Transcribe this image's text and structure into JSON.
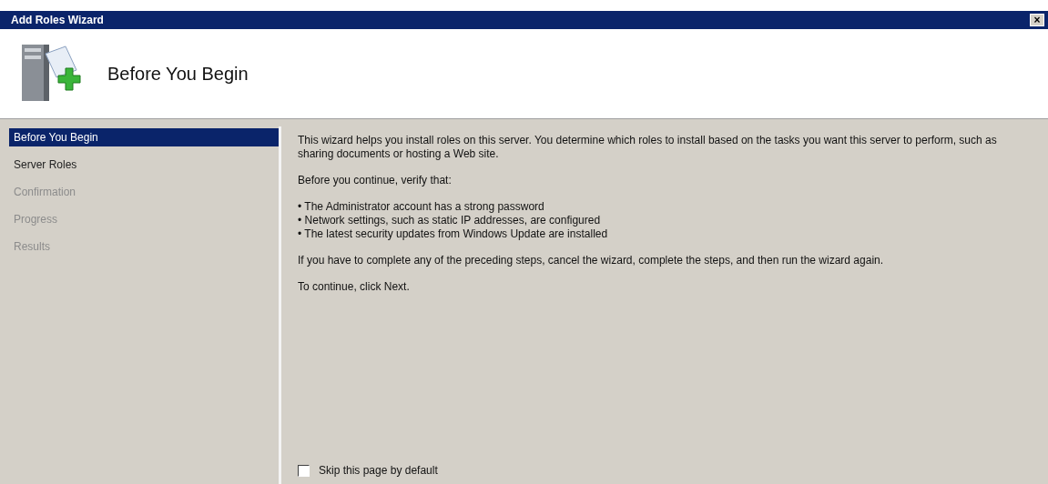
{
  "window": {
    "title": "Add Roles Wizard",
    "close": "×"
  },
  "header": {
    "title": "Before You Begin"
  },
  "steps": [
    {
      "label": "Before You Begin",
      "selected": true,
      "disabled": false
    },
    {
      "label": "Server Roles",
      "selected": false,
      "disabled": false
    },
    {
      "label": "Confirmation",
      "selected": false,
      "disabled": true
    },
    {
      "label": "Progress",
      "selected": false,
      "disabled": true
    },
    {
      "label": "Results",
      "selected": false,
      "disabled": true
    }
  ],
  "content": {
    "intro": "This wizard helps you install roles on this server. You determine which roles to install based on the tasks you want this server to perform, such as sharing documents or hosting a Web site.",
    "verify": "Before you continue, verify that:",
    "checklist": [
      "• The Administrator account has a strong password",
      "• Network settings, such as static IP addresses, are configured",
      "• The latest security updates from Windows Update are installed"
    ],
    "preceding": "If you have to complete any of the preceding steps, cancel the wizard, complete the steps, and then run the wizard again.",
    "next": "To continue, click Next."
  },
  "skip_checkbox": {
    "label": "Skip this page by default",
    "checked": false
  }
}
